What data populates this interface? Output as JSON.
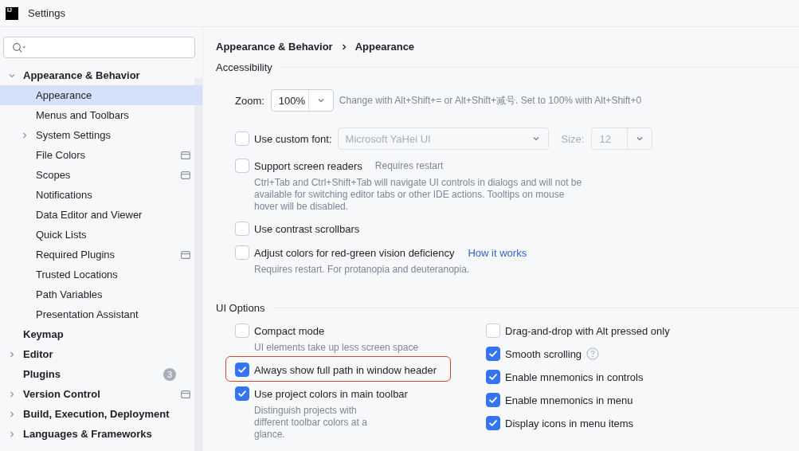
{
  "window": {
    "title": "Settings",
    "logo": "IJ"
  },
  "sidebar": {
    "items": [
      {
        "label": "Appearance & Behavior",
        "selected": false,
        "expanded": true,
        "children": [
          {
            "label": "Appearance",
            "selected": true
          },
          {
            "label": "Menus and Toolbars",
            "selected": false
          },
          {
            "label": "System Settings",
            "selected": false,
            "expanded": false
          },
          {
            "label": "File Colors",
            "selected": false,
            "project_level": true
          },
          {
            "label": "Scopes",
            "selected": false,
            "project_level": true
          },
          {
            "label": "Notifications",
            "selected": false
          },
          {
            "label": "Data Editor and Viewer",
            "selected": false
          },
          {
            "label": "Quick Lists",
            "selected": false
          },
          {
            "label": "Required Plugins",
            "selected": false,
            "project_level": true
          },
          {
            "label": "Trusted Locations",
            "selected": false
          },
          {
            "label": "Path Variables",
            "selected": false
          },
          {
            "label": "Presentation Assistant",
            "selected": false
          }
        ]
      },
      {
        "label": "Keymap",
        "selected": false
      },
      {
        "label": "Editor",
        "selected": false,
        "expanded": false
      },
      {
        "label": "Plugins",
        "selected": false,
        "badge": "3"
      },
      {
        "label": "Version Control",
        "selected": false,
        "expanded": false,
        "project_level": true
      },
      {
        "label": "Build, Execution, Deployment",
        "selected": false,
        "expanded": false
      },
      {
        "label": "Languages & Frameworks",
        "selected": false,
        "expanded": false
      }
    ]
  },
  "breadcrumb": [
    "Appearance & Behavior",
    "Appearance"
  ],
  "accessibility": {
    "title": "Accessibility",
    "zoom": {
      "label": "Zoom:",
      "value": "100%",
      "hint": "Change with Alt+Shift+= or Alt+Shift+减号. Set to 100% with Alt+Shift+0"
    },
    "options": [
      {
        "kind": "font",
        "label": "Use custom font:",
        "checked": false,
        "font": {
          "value": "Microsoft YaHei UI",
          "disabled": true
        },
        "size_label": "Size:",
        "size": {
          "value": "12",
          "disabled": true
        }
      },
      {
        "kind": "checkbox",
        "label": "Support screen readers",
        "checked": false,
        "note": "Requires restart",
        "description": "Ctrl+Tab and Ctrl+Shift+Tab will navigate UI controls in dialogs and will not be available for switching editor tabs or other IDE actions. Tooltips on mouse hover will be disabled."
      },
      {
        "kind": "checkbox",
        "label": "Use contrast scrollbars",
        "checked": false
      },
      {
        "kind": "checkbox",
        "label": "Adjust colors for red-green vision deficiency",
        "checked": false,
        "link": "How it works",
        "description": "Requires restart. For protanopia and deuteranopia."
      }
    ]
  },
  "ui_options": {
    "title": "UI Options",
    "left": [
      {
        "label": "Compact mode",
        "checked": false,
        "description": "UI elements take up less screen space"
      },
      {
        "label": "Always show full path in window header",
        "checked": true,
        "highlighted": true
      },
      {
        "label": "Use project colors in main toolbar",
        "checked": true,
        "description": "Distinguish projects with\ndifferent toolbar colors at a\nglance."
      }
    ],
    "right": [
      {
        "label": "Drag-and-drop with Alt pressed only",
        "checked": false
      },
      {
        "label": "Smooth scrolling",
        "checked": true,
        "help": true
      },
      {
        "label": "Enable mnemonics in controls",
        "checked": true
      },
      {
        "label": "Enable mnemonics in menu",
        "checked": true
      },
      {
        "label": "Display icons in menu items",
        "checked": true
      }
    ]
  }
}
